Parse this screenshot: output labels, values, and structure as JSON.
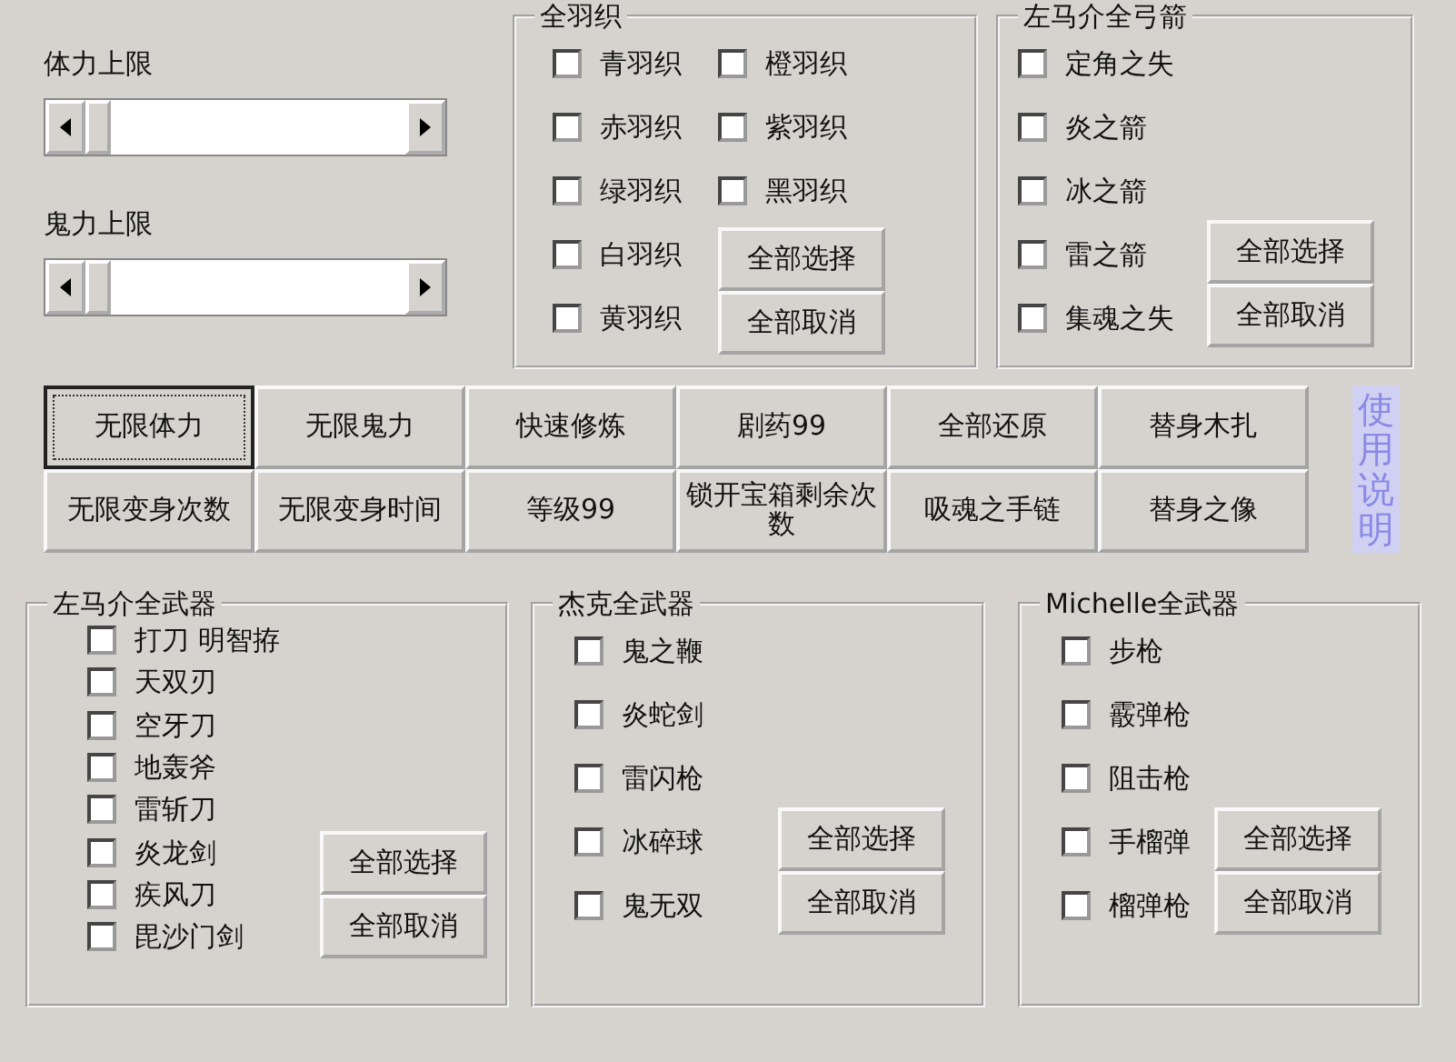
{
  "sliders": [
    {
      "label": "体力上限"
    },
    {
      "label": "鬼力上限"
    }
  ],
  "top_groups": [
    {
      "title": "全羽织",
      "kind": "grid",
      "items": [
        {
          "label": "青羽织",
          "checked": false
        },
        {
          "label": "赤羽织",
          "checked": false
        },
        {
          "label": "绿羽织",
          "checked": false
        },
        {
          "label": "白羽织",
          "checked": false
        },
        {
          "label": "黄羽织",
          "checked": false
        },
        {
          "label": "橙羽织",
          "checked": false
        },
        {
          "label": "紫羽织",
          "checked": false
        },
        {
          "label": "黑羽织",
          "checked": false
        }
      ],
      "buttons": [
        "全部选择",
        "全部取消"
      ]
    },
    {
      "title": "左马介全弓箭",
      "kind": "list",
      "items": [
        {
          "label": "定角之失",
          "checked": false
        },
        {
          "label": "炎之箭",
          "checked": false
        },
        {
          "label": "冰之箭",
          "checked": false
        },
        {
          "label": "雷之箭",
          "checked": false
        },
        {
          "label": "集魂之失",
          "checked": false
        }
      ],
      "buttons": [
        "全部选择",
        "全部取消"
      ]
    }
  ],
  "action_buttons": [
    {
      "label": "无限体力",
      "focused": true
    },
    {
      "label": "无限鬼力",
      "focused": false
    },
    {
      "label": "快速修炼",
      "focused": false
    },
    {
      "label": "剧药99",
      "focused": false
    },
    {
      "label": "全部还原",
      "focused": false
    },
    {
      "label": "替身木扎",
      "focused": false
    },
    {
      "label": "无限变身次数",
      "focused": false
    },
    {
      "label": "无限变身时间",
      "focused": false
    },
    {
      "label": "等级99",
      "focused": false
    },
    {
      "label": "锁开宝箱剩余次数",
      "focused": false
    },
    {
      "label": "吸魂之手链",
      "focused": false
    },
    {
      "label": "替身之像",
      "focused": false
    }
  ],
  "help_label": "使用说明",
  "bottom_groups": [
    {
      "title": "左马介全武器",
      "kind": "compact",
      "items": [
        {
          "label": "打刀 明智拵",
          "checked": false
        },
        {
          "label": "天双刃",
          "checked": false
        },
        {
          "label": "空牙刀",
          "checked": false
        },
        {
          "label": "地轰斧",
          "checked": false
        },
        {
          "label": "雷斩刀",
          "checked": false
        },
        {
          "label": "炎龙剑",
          "checked": false
        },
        {
          "label": "疾风刀",
          "checked": false
        },
        {
          "label": "毘沙门剑",
          "checked": false
        }
      ],
      "buttons": [
        "全部选择",
        "全部取消"
      ]
    },
    {
      "title": "杰克全武器",
      "kind": "list",
      "items": [
        {
          "label": "鬼之鞭",
          "checked": false
        },
        {
          "label": "炎蛇剑",
          "checked": false
        },
        {
          "label": "雷闪枪",
          "checked": false
        },
        {
          "label": "冰碎球",
          "checked": false
        },
        {
          "label": "鬼无双",
          "checked": false
        }
      ],
      "buttons": [
        "全部选择",
        "全部取消"
      ]
    },
    {
      "title": "Michelle全武器",
      "kind": "list",
      "items": [
        {
          "label": "步枪",
          "checked": false
        },
        {
          "label": "霰弹枪",
          "checked": false
        },
        {
          "label": "阻击枪",
          "checked": false
        },
        {
          "label": "手榴弹",
          "checked": false
        },
        {
          "label": "榴弹枪",
          "checked": false
        }
      ],
      "buttons": [
        "全部选择",
        "全部取消"
      ]
    }
  ]
}
